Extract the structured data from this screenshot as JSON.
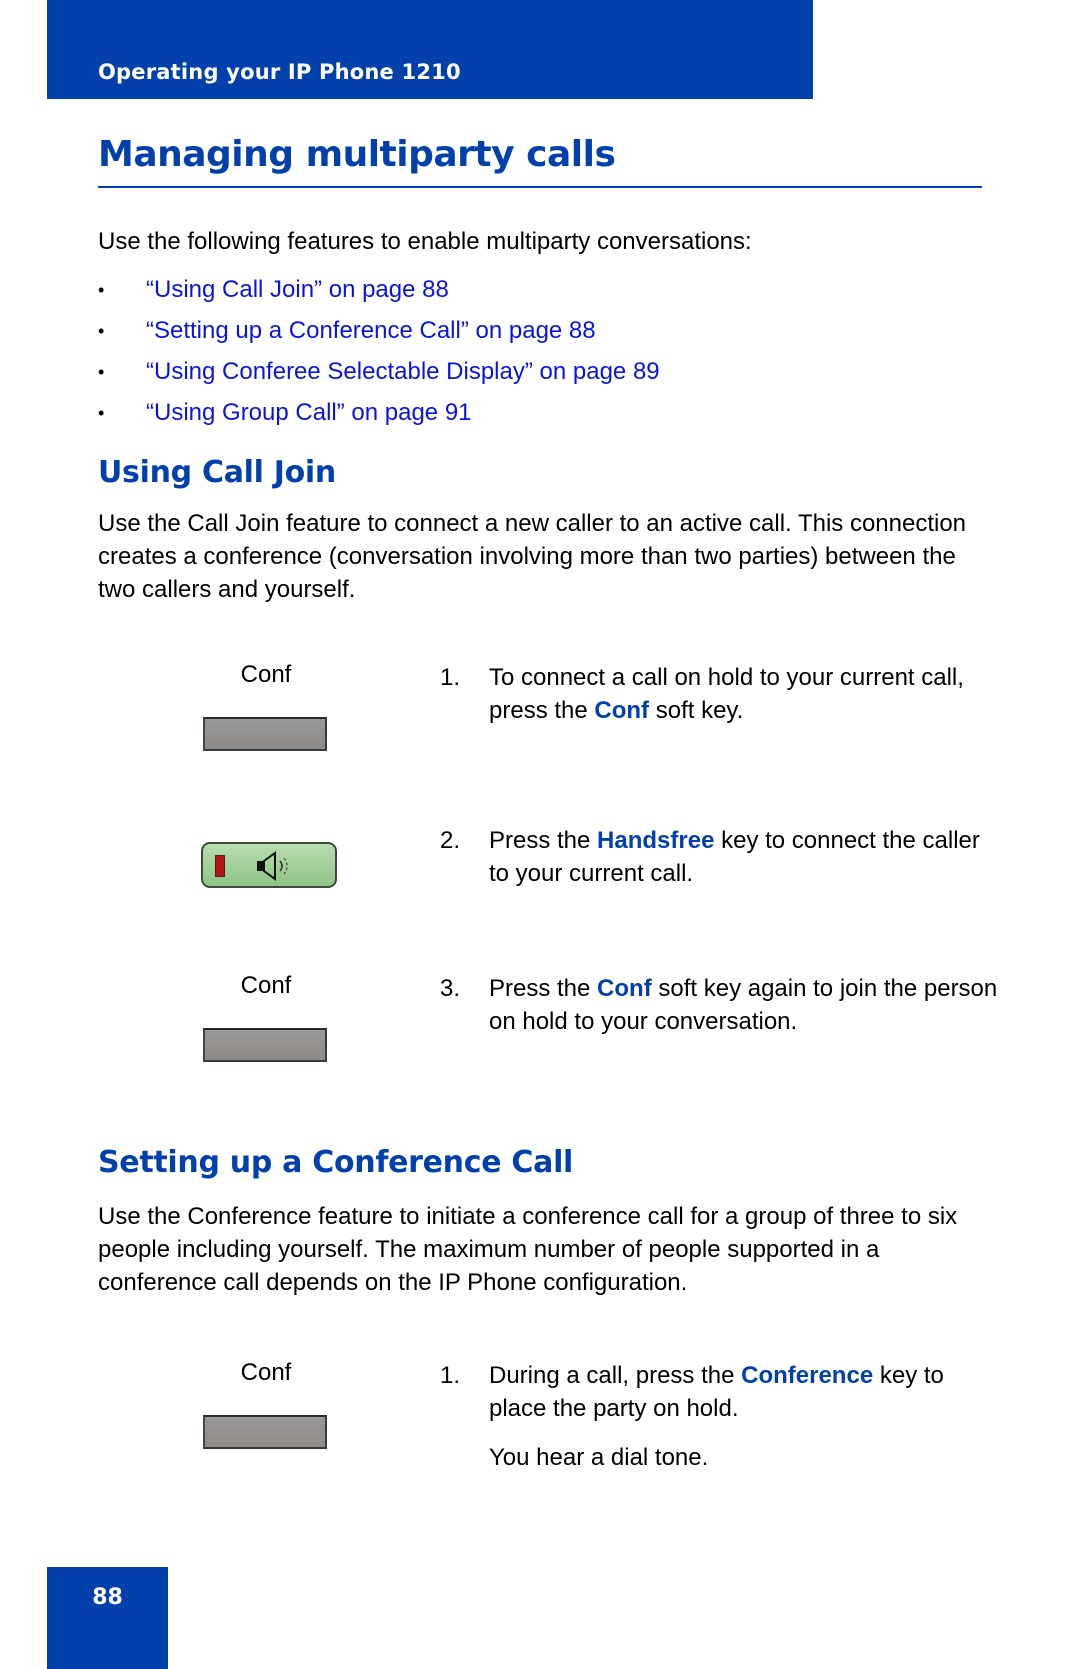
{
  "header": {
    "running_title": "Operating your IP Phone 1210"
  },
  "page_title": "Managing multiparty calls",
  "intro": "Use the following features to enable multiparty conversations:",
  "bullet_char": "•",
  "links": [
    {
      "label": "“Using Call Join” on page 88"
    },
    {
      "label": "“Setting up a Conference Call” on page 88"
    },
    {
      "label": "“Using Conferee Selectable Display” on page 89"
    },
    {
      "label": "“Using Group Call” on page 91"
    }
  ],
  "call_join": {
    "title": "Using Call Join",
    "description": "Use the Call Join feature to connect a new caller to an active call. This connection creates a conference (conversation involving more than two parties) between the two callers and yourself.",
    "steps": [
      {
        "number": "1.",
        "before": "To connect a call on hold to your current call, press the ",
        "highlight": "Conf",
        "after": " soft key.",
        "key_type": "softkey",
        "key_label": "Conf"
      },
      {
        "number": "2.",
        "before": "Press the ",
        "highlight": "Handsfree",
        "after": " key to connect the caller to your current call.",
        "key_type": "handsfree-key",
        "key_label": ""
      },
      {
        "number": "3.",
        "before": "Press the ",
        "highlight": "Conf",
        "after": " soft key again to join the person on hold to your conversation.",
        "key_type": "softkey",
        "key_label": "Conf"
      }
    ]
  },
  "conference": {
    "title": "Setting up a Conference Call",
    "description": "Use the Conference feature to initiate a conference call for a group of three to six people including yourself. The maximum number of people supported in a conference call depends on the IP Phone configuration.",
    "steps": [
      {
        "number": "1.",
        "before": "During a call, press the ",
        "highlight": "Conference",
        "after": " key to place the party on hold.",
        "note": "You hear a dial tone.",
        "key_type": "softkey",
        "key_label": "Conf"
      }
    ]
  },
  "footer": {
    "page_number": "88"
  },
  "colors": {
    "brand_blue": "#0340ac",
    "link_blue": "#0a14e0"
  }
}
